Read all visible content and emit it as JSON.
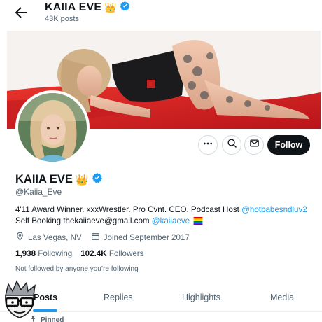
{
  "header": {
    "title": "KAIIA EVE",
    "crown_emoji": "👑",
    "posts_count": "43K posts"
  },
  "profile": {
    "name": "KAIIA EVE",
    "crown_emoji": "👑",
    "handle": "@Kaiia_Eve",
    "bio_line1_text": "4'11 Award Winner. xxxWrestler. Pro Cvnt. CEO. Podcast Host ",
    "bio_line1_link": "@hotbabesndluv2",
    "bio_line2_text": "Self Booking thekaiiaeve@gmail.com ",
    "bio_line2_link": "@kaiiaeve",
    "location": "Las Vegas, NV",
    "joined": "Joined September 2017",
    "following_count": "1,938",
    "following_label": "Following",
    "followers_count": "102.4K",
    "followers_label": "Followers",
    "not_followed_note": "Not followed by anyone you’re following"
  },
  "actions": {
    "follow_label": "Follow"
  },
  "tabs": [
    {
      "label": "Posts",
      "active": true
    },
    {
      "label": "Replies",
      "active": false
    },
    {
      "label": "Highlights",
      "active": false
    },
    {
      "label": "Media",
      "active": false
    }
  ],
  "pinned_label": "Pinned",
  "colors": {
    "accent": "#1d9bf0",
    "text": "#0f1419",
    "muted": "#536471",
    "banner_red": "#d71f1f",
    "follow_button": "#0f1419"
  },
  "icons": [
    "back-arrow-icon",
    "verified-badge-icon",
    "more-icon",
    "search-icon",
    "message-icon",
    "location-icon",
    "calendar-icon",
    "pin-icon",
    "pride-flag-icon"
  ]
}
